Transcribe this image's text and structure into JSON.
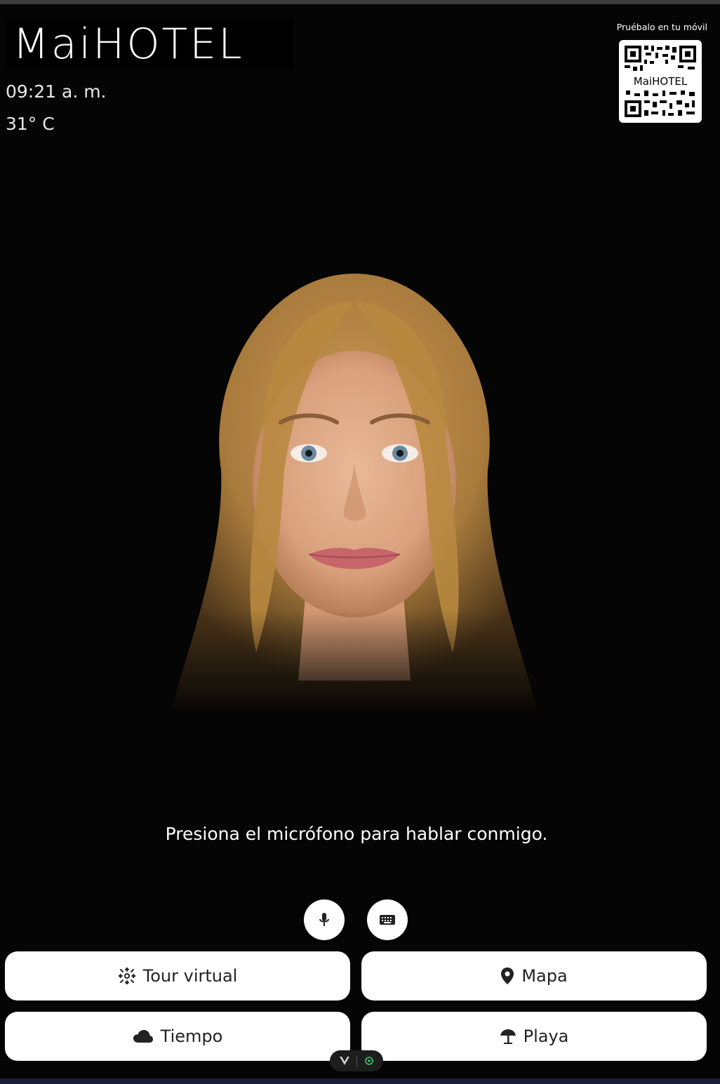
{
  "brand": {
    "logo_text": "MaiHOTEL"
  },
  "status": {
    "time": "09:21 a. m.",
    "temperature": "31° C"
  },
  "qr": {
    "caption": "Pruébalo en tu móvil"
  },
  "assistant": {
    "prompt": "Presiona el micrófono para hablar conmigo."
  },
  "controls": {
    "mic_icon": "microphone-icon",
    "keyboard_icon": "keyboard-icon"
  },
  "actions": [
    {
      "label": "Tour virtual",
      "icon": "virtual-tour-icon"
    },
    {
      "label": "Mapa",
      "icon": "map-pin-icon"
    },
    {
      "label": "Tiempo",
      "icon": "cloud-icon"
    },
    {
      "label": "Playa",
      "icon": "beach-umbrella-icon"
    }
  ],
  "colors": {
    "background": "#050505",
    "button_bg": "#ffffff",
    "button_text": "#222222",
    "accent_green": "#2ecc71"
  }
}
